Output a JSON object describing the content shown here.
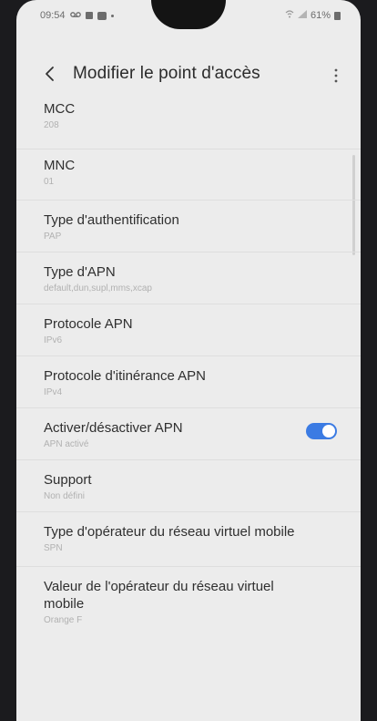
{
  "statusbar": {
    "time": "09:54",
    "battery": "61%"
  },
  "header": {
    "title": "Modifier le point d'accès"
  },
  "items": [
    {
      "title": "MCC",
      "value": "208"
    },
    {
      "title": "MNC",
      "value": "01"
    },
    {
      "title": "Type d'authentification",
      "value": "PAP"
    },
    {
      "title": "Type d'APN",
      "value": "default,dun,supl,mms,xcap"
    },
    {
      "title": "Protocole APN",
      "value": "IPv6"
    },
    {
      "title": "Protocole d'itinérance APN",
      "value": "IPv4"
    },
    {
      "title": "Activer/désactiver APN",
      "value": "APN activé",
      "toggle": true
    },
    {
      "title": "Support",
      "value": "Non défini"
    },
    {
      "title": "Type d'opérateur du réseau virtuel mobile",
      "value": "SPN"
    },
    {
      "title": "Valeur de l'opérateur du réseau virtuel mobile",
      "value": "Orange F"
    }
  ],
  "colors": {
    "accent": "#3b7be3",
    "background": "#ececec"
  }
}
